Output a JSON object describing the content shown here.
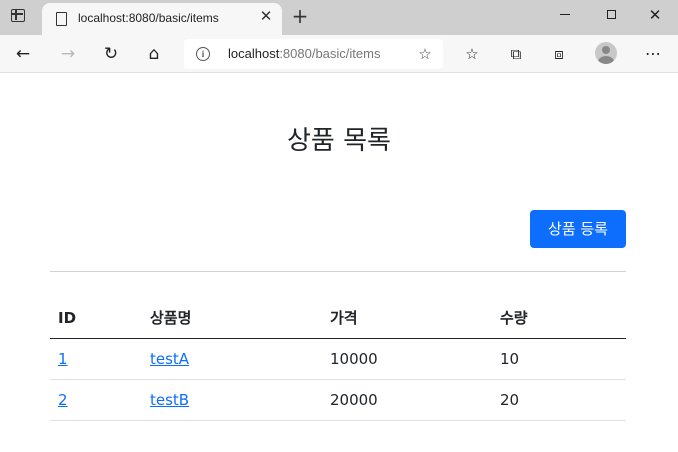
{
  "browser": {
    "tab_title": "localhost:8080/basic/items",
    "url_host": "localhost",
    "url_path": ":8080/basic/items"
  },
  "icons": {
    "window_menu": "window-icon",
    "tab_page": "page-icon",
    "tab_close": "close-icon",
    "new_tab": "plus-icon",
    "back": "arrow-left-icon",
    "forward": "arrow-right-icon",
    "refresh": "refresh-icon",
    "home": "home-icon",
    "info": "info-icon",
    "add_favorite": "star-plus-icon",
    "favorites": "favorites-icon",
    "collections": "collections-icon",
    "extensions": "extensions-icon",
    "profile": "avatar-icon",
    "more": "more-icon"
  },
  "page": {
    "title": "상품 목록",
    "add_button_label": "상품 등록",
    "accent_color": "#0d6efd"
  },
  "table": {
    "headers": [
      "ID",
      "상품명",
      "가격",
      "수량"
    ],
    "rows": [
      {
        "id": "1",
        "name": "testA",
        "price": "10000",
        "quantity": "10"
      },
      {
        "id": "2",
        "name": "testB",
        "price": "20000",
        "quantity": "20"
      }
    ]
  }
}
